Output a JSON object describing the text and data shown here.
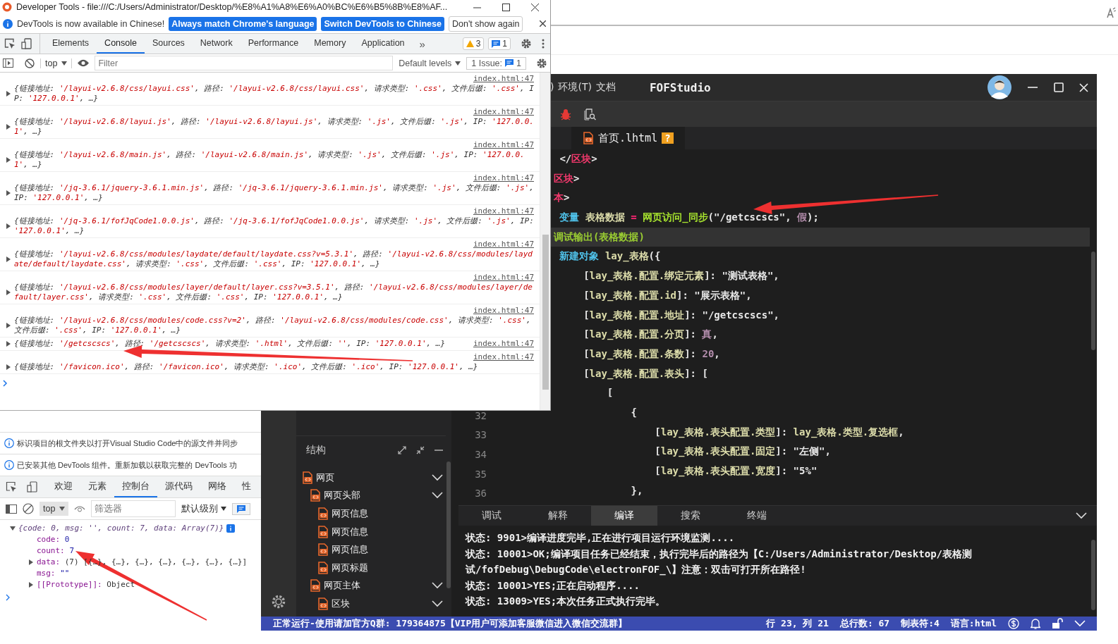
{
  "devtools": {
    "title": "Developer Tools - file:///C:/Users/Administrator/Desktop/%E8%A1%A8%E6%A0%BC%E6%B5%8B%E8%AF...",
    "infobar": {
      "message": "DevTools is now available in Chinese!",
      "buttons": [
        {
          "label": "Always match Chrome's language",
          "kind": "primary"
        },
        {
          "label": "Switch DevTools to Chinese",
          "kind": "primary"
        },
        {
          "label": "Don't show again",
          "kind": "plain"
        }
      ]
    },
    "tabs": [
      {
        "label": "Elements",
        "selected": false
      },
      {
        "label": "Console",
        "selected": true
      },
      {
        "label": "Sources",
        "selected": false
      },
      {
        "label": "Network",
        "selected": false
      },
      {
        "label": "Performance",
        "selected": false
      },
      {
        "label": "Memory",
        "selected": false
      },
      {
        "label": "Application",
        "selected": false
      }
    ],
    "more": "»",
    "warnings": "3",
    "messages": "1",
    "toolbar": {
      "context": "top",
      "filter_placeholder": "Filter",
      "levels": "Default levels",
      "issues": "1 Issue:",
      "issue_count": "1"
    },
    "log": [
      {
        "source": "index.html:47",
        "parts": [
          {
            "kind": "key",
            "text": "{链接地址: "
          },
          {
            "kind": "value",
            "text": "'/layui-v2.6.8/css/layui.css'"
          },
          {
            "kind": "key",
            "text": ", 路径: "
          },
          {
            "kind": "value",
            "text": "'/layui-v2.6.8/css/layui.css'"
          },
          {
            "kind": "key",
            "text": ", 请求类型: "
          },
          {
            "kind": "value",
            "text": "'.css'"
          },
          {
            "kind": "key",
            "text": ", 文件后缀: "
          },
          {
            "kind": "value",
            "text": "'.css'"
          },
          {
            "kind": "key",
            "text": ", IP: "
          },
          {
            "kind": "value",
            "text": "'127.0.0.1'"
          },
          {
            "kind": "key",
            "text": ", …}"
          }
        ]
      },
      {
        "source": "index.html:47",
        "parts": [
          {
            "kind": "key",
            "text": "{链接地址: "
          },
          {
            "kind": "value",
            "text": "'/layui-v2.6.8/layui.js'"
          },
          {
            "kind": "key",
            "text": ", 路径: "
          },
          {
            "kind": "value",
            "text": "'/layui-v2.6.8/layui.js'"
          },
          {
            "kind": "key",
            "text": ", 请求类型: "
          },
          {
            "kind": "value",
            "text": "'.js'"
          },
          {
            "kind": "key",
            "text": ", 文件后缀: "
          },
          {
            "kind": "value",
            "text": "'.js'"
          },
          {
            "kind": "key",
            "text": ", IP: "
          },
          {
            "kind": "value",
            "text": "'127.0.0.1'"
          },
          {
            "kind": "key",
            "text": ", …}"
          }
        ]
      },
      {
        "source": "index.html:47",
        "parts": [
          {
            "kind": "key",
            "text": "{链接地址: "
          },
          {
            "kind": "value",
            "text": "'/layui-v2.6.8/main.js'"
          },
          {
            "kind": "key",
            "text": ", 路径: "
          },
          {
            "kind": "value",
            "text": "'/layui-v2.6.8/main.js'"
          },
          {
            "kind": "key",
            "text": ", 请求类型: "
          },
          {
            "kind": "value",
            "text": "'.js'"
          },
          {
            "kind": "key",
            "text": ", 文件后缀: "
          },
          {
            "kind": "value",
            "text": "'.js'"
          },
          {
            "kind": "key",
            "text": ", IP: "
          },
          {
            "kind": "value",
            "text": "'127.0.0.1'"
          },
          {
            "kind": "key",
            "text": ", …}"
          }
        ]
      },
      {
        "source": "index.html:47",
        "parts": [
          {
            "kind": "key",
            "text": "{链接地址: "
          },
          {
            "kind": "value",
            "text": "'/jq-3.6.1/jquery-3.6.1.min.js'"
          },
          {
            "kind": "key",
            "text": ", 路径: "
          },
          {
            "kind": "value",
            "text": "'/jq-3.6.1/jquery-3.6.1.min.js'"
          },
          {
            "kind": "key",
            "text": ", 请求类型: "
          },
          {
            "kind": "value",
            "text": "'.js'"
          },
          {
            "kind": "key",
            "text": ", 文件后缀: "
          },
          {
            "kind": "value",
            "text": "'.js'"
          },
          {
            "kind": "key",
            "text": ", IP: "
          },
          {
            "kind": "value",
            "text": "'127.0.0.1'"
          },
          {
            "kind": "key",
            "text": ", …}"
          }
        ]
      },
      {
        "source": "index.html:47",
        "parts": [
          {
            "kind": "key",
            "text": "{链接地址: "
          },
          {
            "kind": "value",
            "text": "'/jq-3.6.1/fofJqCode1.0.0.js'"
          },
          {
            "kind": "key",
            "text": ", 路径: "
          },
          {
            "kind": "value",
            "text": "'/jq-3.6.1/fofJqCode1.0.0.js'"
          },
          {
            "kind": "key",
            "text": ", 请求类型: "
          },
          {
            "kind": "value",
            "text": "'.js'"
          },
          {
            "kind": "key",
            "text": ", 文件后缀: "
          },
          {
            "kind": "value",
            "text": "'.js'"
          },
          {
            "kind": "key",
            "text": ", IP: "
          },
          {
            "kind": "value",
            "text": "'127.0.0.1'"
          },
          {
            "kind": "key",
            "text": ", …}"
          }
        ]
      },
      {
        "source": "index.html:47",
        "parts": [
          {
            "kind": "key",
            "text": "{链接地址: "
          },
          {
            "kind": "value",
            "text": "'/layui-v2.6.8/css/modules/laydate/default/laydate.css?v=5.3.1'"
          },
          {
            "kind": "key",
            "text": ", 路径: "
          },
          {
            "kind": "value",
            "text": "'/layui-v2.6.8/css/modules/laydate/default/laydate.css'"
          },
          {
            "kind": "key",
            "text": ", 请求类型: "
          },
          {
            "kind": "value",
            "text": "'.css'"
          },
          {
            "kind": "key",
            "text": ", 文件后缀: "
          },
          {
            "kind": "value",
            "text": "'.css'"
          },
          {
            "kind": "key",
            "text": ", IP: "
          },
          {
            "kind": "value",
            "text": "'127.0.0.1'"
          },
          {
            "kind": "key",
            "text": ", …}"
          }
        ]
      },
      {
        "source": "index.html:47",
        "parts": [
          {
            "kind": "key",
            "text": "{链接地址: "
          },
          {
            "kind": "value",
            "text": "'/layui-v2.6.8/css/modules/layer/default/layer.css?v=3.5.1'"
          },
          {
            "kind": "key",
            "text": ", 路径: "
          },
          {
            "kind": "value",
            "text": "'/layui-v2.6.8/css/modules/layer/default/layer.css'"
          },
          {
            "kind": "key",
            "text": ", 请求类型: "
          },
          {
            "kind": "value",
            "text": "'.css'"
          },
          {
            "kind": "key",
            "text": ", 文件后缀: "
          },
          {
            "kind": "value",
            "text": "'.css'"
          },
          {
            "kind": "key",
            "text": ", IP: "
          },
          {
            "kind": "value",
            "text": "'127.0.0.1'"
          },
          {
            "kind": "key",
            "text": ", …}"
          }
        ]
      },
      {
        "source": "index.html:47",
        "parts": [
          {
            "kind": "key",
            "text": "{链接地址: "
          },
          {
            "kind": "value",
            "text": "'/layui-v2.6.8/css/modules/code.css?v=2'"
          },
          {
            "kind": "key",
            "text": ", 路径: "
          },
          {
            "kind": "value",
            "text": "'/layui-v2.6.8/css/modules/code.css'"
          },
          {
            "kind": "key",
            "text": ", 请求类型: "
          },
          {
            "kind": "value",
            "text": "'.css'"
          },
          {
            "kind": "key",
            "text": ", 文件后缀: "
          },
          {
            "kind": "value",
            "text": "'.css'"
          },
          {
            "kind": "key",
            "text": ", IP: "
          },
          {
            "kind": "value",
            "text": "'127.0.0.1'"
          },
          {
            "kind": "key",
            "text": ", …}"
          }
        ]
      },
      {
        "source": "index.html:47",
        "parts": [
          {
            "kind": "key",
            "text": "{链接地址: "
          },
          {
            "kind": "value",
            "text": "'/getcscscs'"
          },
          {
            "kind": "key",
            "text": ", 路径: "
          },
          {
            "kind": "value",
            "text": "'/getcscscs'"
          },
          {
            "kind": "key",
            "text": ", 请求类型: "
          },
          {
            "kind": "value",
            "text": "'.html'"
          },
          {
            "kind": "key",
            "text": ", 文件后缀: "
          },
          {
            "kind": "value",
            "text": "''"
          },
          {
            "kind": "key",
            "text": ", IP: "
          },
          {
            "kind": "value",
            "text": "'127.0.0.1'"
          },
          {
            "kind": "key",
            "text": ", …}"
          }
        ]
      },
      {
        "source": "index.html:47",
        "parts": [
          {
            "kind": "key",
            "text": "{链接地址: "
          },
          {
            "kind": "value",
            "text": "'/favicon.ico'"
          },
          {
            "kind": "key",
            "text": ", 路径: "
          },
          {
            "kind": "value",
            "text": "'/favicon.ico'"
          },
          {
            "kind": "key",
            "text": ", 请求类型: "
          },
          {
            "kind": "value",
            "text": "'.ico'"
          },
          {
            "kind": "key",
            "text": ", 文件后缀: "
          },
          {
            "kind": "value",
            "text": "'.ico'"
          },
          {
            "kind": "key",
            "text": ", IP: "
          },
          {
            "kind": "value",
            "text": "'127.0.0.1'"
          },
          {
            "kind": "key",
            "text": ", …}"
          }
        ]
      }
    ]
  },
  "devtools_cn": {
    "notices": [
      "标识项目的根文件夹以打开Visual Studio Code中的源文件并同步",
      "已安装其他 DevTools 组件。重新加载以获取完整的 DevTools 功"
    ],
    "tabs": [
      {
        "label": "欢迎",
        "selected": false
      },
      {
        "label": "元素",
        "selected": false
      },
      {
        "label": "控制台",
        "selected": true
      },
      {
        "label": "源代码",
        "selected": false
      },
      {
        "label": "网络",
        "selected": false
      },
      {
        "label": "性",
        "selected": false
      }
    ],
    "toolbar": {
      "context": "top",
      "filter_placeholder": "筛选器",
      "levels": "默认级别"
    },
    "output": [
      {
        "kind": "object",
        "expanded": true,
        "text": "{code: 0, msg: '', count: 7, data: Array(7)}",
        "children": [
          {
            "kind": "property",
            "key": "code:",
            "value": "0"
          },
          {
            "kind": "property",
            "key": "count:",
            "value": "7"
          },
          {
            "kind": "group",
            "key": "data:",
            "value": "(7) [{…}, {…}, {…}, {…}, {…}, {…}, {…}]",
            "expanded": false
          },
          {
            "kind": "property",
            "key": "msg:",
            "value": "\"\""
          },
          {
            "kind": "group",
            "key": "[[Prototype]]:",
            "value": "Object",
            "expanded": false
          }
        ]
      }
    ]
  },
  "fofstudio": {
    "menu": [
      ")",
      "环境(T)",
      "文档"
    ],
    "title": "FOFStudio",
    "editor_tab": {
      "label": "首页.lhtml",
      "badge": "?"
    },
    "code": [
      {
        "current": false,
        "tokens": [
          {
            "kind": "punct",
            "text": "        </"
          },
          {
            "kind": "tag",
            "text": "区块"
          },
          {
            "kind": "punct",
            "text": ">"
          }
        ]
      },
      {
        "current": false,
        "tokens": [
          {
            "kind": "tag",
            "text": "       区块"
          },
          {
            "kind": "punct",
            "text": ">"
          }
        ]
      },
      {
        "current": false,
        "tokens": [
          {
            "kind": "tag",
            "text": "       本"
          },
          {
            "kind": "punct",
            "text": ">"
          }
        ]
      },
      {
        "current": false,
        "tokens": [
          {
            "kind": "keyword",
            "text": "        变量"
          },
          {
            "kind": "name",
            "text": " 表格数据 "
          },
          {
            "kind": "op",
            "text": "="
          },
          {
            "kind": "func",
            "text": " 网页访问_同步"
          },
          {
            "kind": "punct",
            "text": "(\"/getcscscs\", "
          },
          {
            "kind": "literal",
            "text": "假"
          },
          {
            "kind": "punct",
            "text": ");"
          }
        ]
      },
      {
        "current": true,
        "tokens": [
          {
            "kind": "call",
            "text": "       调试输出(表格数据)"
          }
        ]
      },
      {
        "current": false,
        "tokens": [
          {
            "kind": "keyword",
            "text": "        新建对象 "
          },
          {
            "kind": "name",
            "text": "lay_表格"
          },
          {
            "kind": "punct",
            "text": "({"
          }
        ]
      },
      {
        "current": false,
        "tokens": [
          {
            "kind": "punct",
            "text": "            ["
          },
          {
            "kind": "name",
            "text": "lay_表格.配置.绑定元素"
          },
          {
            "kind": "punct",
            "text": "]: \"测试表格\","
          }
        ]
      },
      {
        "current": false,
        "tokens": [
          {
            "kind": "punct",
            "text": "            ["
          },
          {
            "kind": "name",
            "text": "lay_表格.配置.id"
          },
          {
            "kind": "punct",
            "text": "]: \"展示表格\","
          }
        ]
      },
      {
        "current": false,
        "tokens": [
          {
            "kind": "punct",
            "text": "            ["
          },
          {
            "kind": "name",
            "text": "lay_表格.配置.地址"
          },
          {
            "kind": "punct",
            "text": "]: \"/getcscscs\","
          }
        ]
      },
      {
        "current": false,
        "tokens": [
          {
            "kind": "punct",
            "text": "            ["
          },
          {
            "kind": "name",
            "text": "lay_表格.配置.分页"
          },
          {
            "kind": "punct",
            "text": "]: "
          },
          {
            "kind": "literal",
            "text": "真"
          },
          {
            "kind": "punct",
            "text": ","
          }
        ]
      },
      {
        "current": false,
        "tokens": [
          {
            "kind": "punct",
            "text": "            ["
          },
          {
            "kind": "name",
            "text": "lay_表格.配置.条数"
          },
          {
            "kind": "punct",
            "text": "]: "
          },
          {
            "kind": "literal",
            "text": "20"
          },
          {
            "kind": "punct",
            "text": ","
          }
        ]
      },
      {
        "current": false,
        "tokens": [
          {
            "kind": "punct",
            "text": "            ["
          },
          {
            "kind": "name",
            "text": "lay_表格.配置.表头"
          },
          {
            "kind": "punct",
            "text": "]: ["
          }
        ]
      },
      {
        "current": false,
        "tokens": [
          {
            "kind": "punct",
            "text": "                ["
          }
        ]
      },
      {
        "number": "32",
        "current": false,
        "tokens": [
          {
            "kind": "punct",
            "text": "                    {"
          }
        ]
      },
      {
        "number": "33",
        "current": false,
        "tokens": [
          {
            "kind": "punct",
            "text": "                        ["
          },
          {
            "kind": "name",
            "text": "lay_表格.表头配置.类型"
          },
          {
            "kind": "punct",
            "text": "]: "
          },
          {
            "kind": "name",
            "text": "lay_表格.类型.复选框"
          },
          {
            "kind": "punct",
            "text": ","
          }
        ]
      },
      {
        "number": "34",
        "current": false,
        "tokens": [
          {
            "kind": "punct",
            "text": "                        ["
          },
          {
            "kind": "name",
            "text": "lay_表格.表头配置.固定"
          },
          {
            "kind": "punct",
            "text": "]: \"左侧\","
          }
        ]
      },
      {
        "number": "35",
        "current": false,
        "tokens": [
          {
            "kind": "punct",
            "text": "                        ["
          },
          {
            "kind": "name",
            "text": "lay_表格.表头配置.宽度"
          },
          {
            "kind": "punct",
            "text": "]: \"5%\""
          }
        ]
      },
      {
        "number": "36",
        "current": false,
        "tokens": [
          {
            "kind": "punct",
            "text": "                    },"
          }
        ]
      }
    ],
    "structure": {
      "title": "结构",
      "tree": [
        {
          "label": "网页",
          "expanded": true,
          "children": [
            {
              "label": "网页头部",
              "expanded": true,
              "children": [
                {
                  "label": "网页信息"
                },
                {
                  "label": "网页信息"
                },
                {
                  "label": "网页信息"
                },
                {
                  "label": "网页标题"
                }
              ]
            },
            {
              "label": "网页主体",
              "expanded": true,
              "children": [
                {
                  "label": "区块",
                  "expanded": true
                }
              ]
            }
          ]
        }
      ]
    },
    "panel_tabs": [
      {
        "label": "调试",
        "selected": false
      },
      {
        "label": "解释",
        "selected": false
      },
      {
        "label": "编译",
        "selected": true
      },
      {
        "label": "搜索",
        "selected": false
      },
      {
        "label": "终端",
        "selected": false
      }
    ],
    "output": [
      "状态: 9901>编译进度完毕,正在进行项目运行环境监测....",
      "状态: 10001>OK;编译项目任务已经结束，执行完毕后的路径为【C:/Users/Administrator/Desktop/表格测试/fofDebug\\DebugCode\\electronFOF_\\】注意：双击可打开所在路径!",
      "状态: 10001>YES;正在启动程序....",
      "状态: 13009>YES;本次任务正式执行完毕。"
    ],
    "status": {
      "message": "正常运行-使用请加官方Q群: 179364875【VIP用户可添加客服微信进入微信交流群】",
      "position": "行 23, 列 21",
      "lines": "总行数: 67",
      "tab": "制表符:4",
      "language": "语言:html"
    }
  }
}
